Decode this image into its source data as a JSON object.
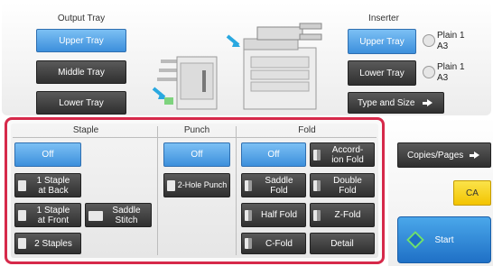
{
  "output_tray": {
    "title": "Output Tray",
    "upper": "Upper Tray",
    "middle": "Middle Tray",
    "lower": "Lower Tray"
  },
  "inserter": {
    "title": "Inserter",
    "upper": "Upper Tray",
    "lower": "Lower Tray",
    "type_size": "Type and Size",
    "upper_paper_type": "Plain 1",
    "upper_paper_size": "A3",
    "lower_paper_type": "Plain 1",
    "lower_paper_size": "A3"
  },
  "staple": {
    "title": "Staple",
    "off": "Off",
    "one_back_l1": "1 Staple",
    "one_back_l2": "at Back",
    "one_front_l1": "1 Staple",
    "one_front_l2": "at Front",
    "saddle_l1": "Saddle",
    "saddle_l2": "Stitch",
    "two": "2 Staples"
  },
  "punch": {
    "title": "Punch",
    "off": "Off",
    "two_hole": "2-Hole Punch"
  },
  "fold": {
    "title": "Fold",
    "off": "Off",
    "accordion_l1": "Accord-",
    "accordion_l2": "ion Fold",
    "saddle_l1": "Saddle",
    "saddle_l2": "Fold",
    "double_l1": "Double",
    "double_l2": "Fold",
    "half": "Half Fold",
    "z": "Z-Fold",
    "c": "C-Fold",
    "detail": "Detail"
  },
  "side": {
    "copies_pages": "Copies/Pages",
    "ca": "CA",
    "start": "Start"
  },
  "colors": {
    "selected": "#3c8fdc",
    "button": "#3a3a3a",
    "highlight_border": "#d6294a",
    "ca": "#f3c400",
    "start": "#1f70c6"
  }
}
